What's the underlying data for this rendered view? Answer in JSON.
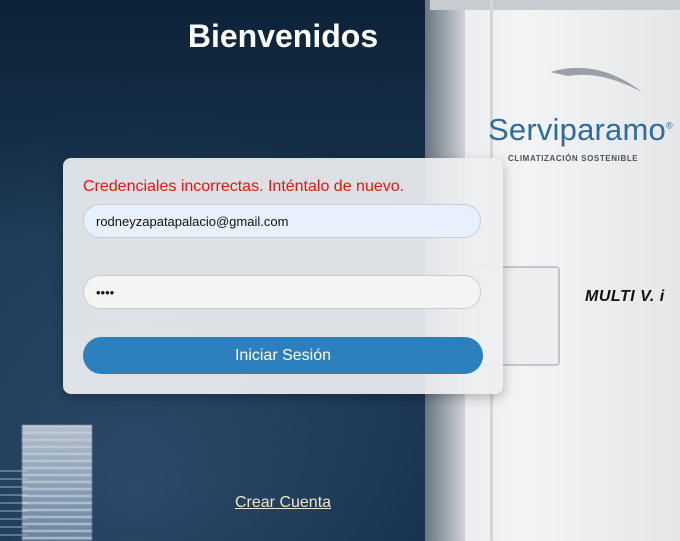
{
  "header": {
    "title": "Bienvenidos"
  },
  "brand": {
    "name": "Serviparamo",
    "trademark": "®",
    "tagline": "CLIMATIZACIÓN SOSTENIBLE",
    "product": "MULTI V. i"
  },
  "login": {
    "error_message": "Credenciales incorrectas. Inténtalo de nuevo.",
    "email_value": "rodneyzapatapalacio@gmail.com",
    "password_value": "••••",
    "submit_label": "Iniciar Sesión"
  },
  "footer": {
    "create_account_label": "Crear Cuenta"
  },
  "colors": {
    "primary_button": "#2b80bd",
    "error": "#ee1111",
    "brand_blue": "#2f6c9a"
  }
}
